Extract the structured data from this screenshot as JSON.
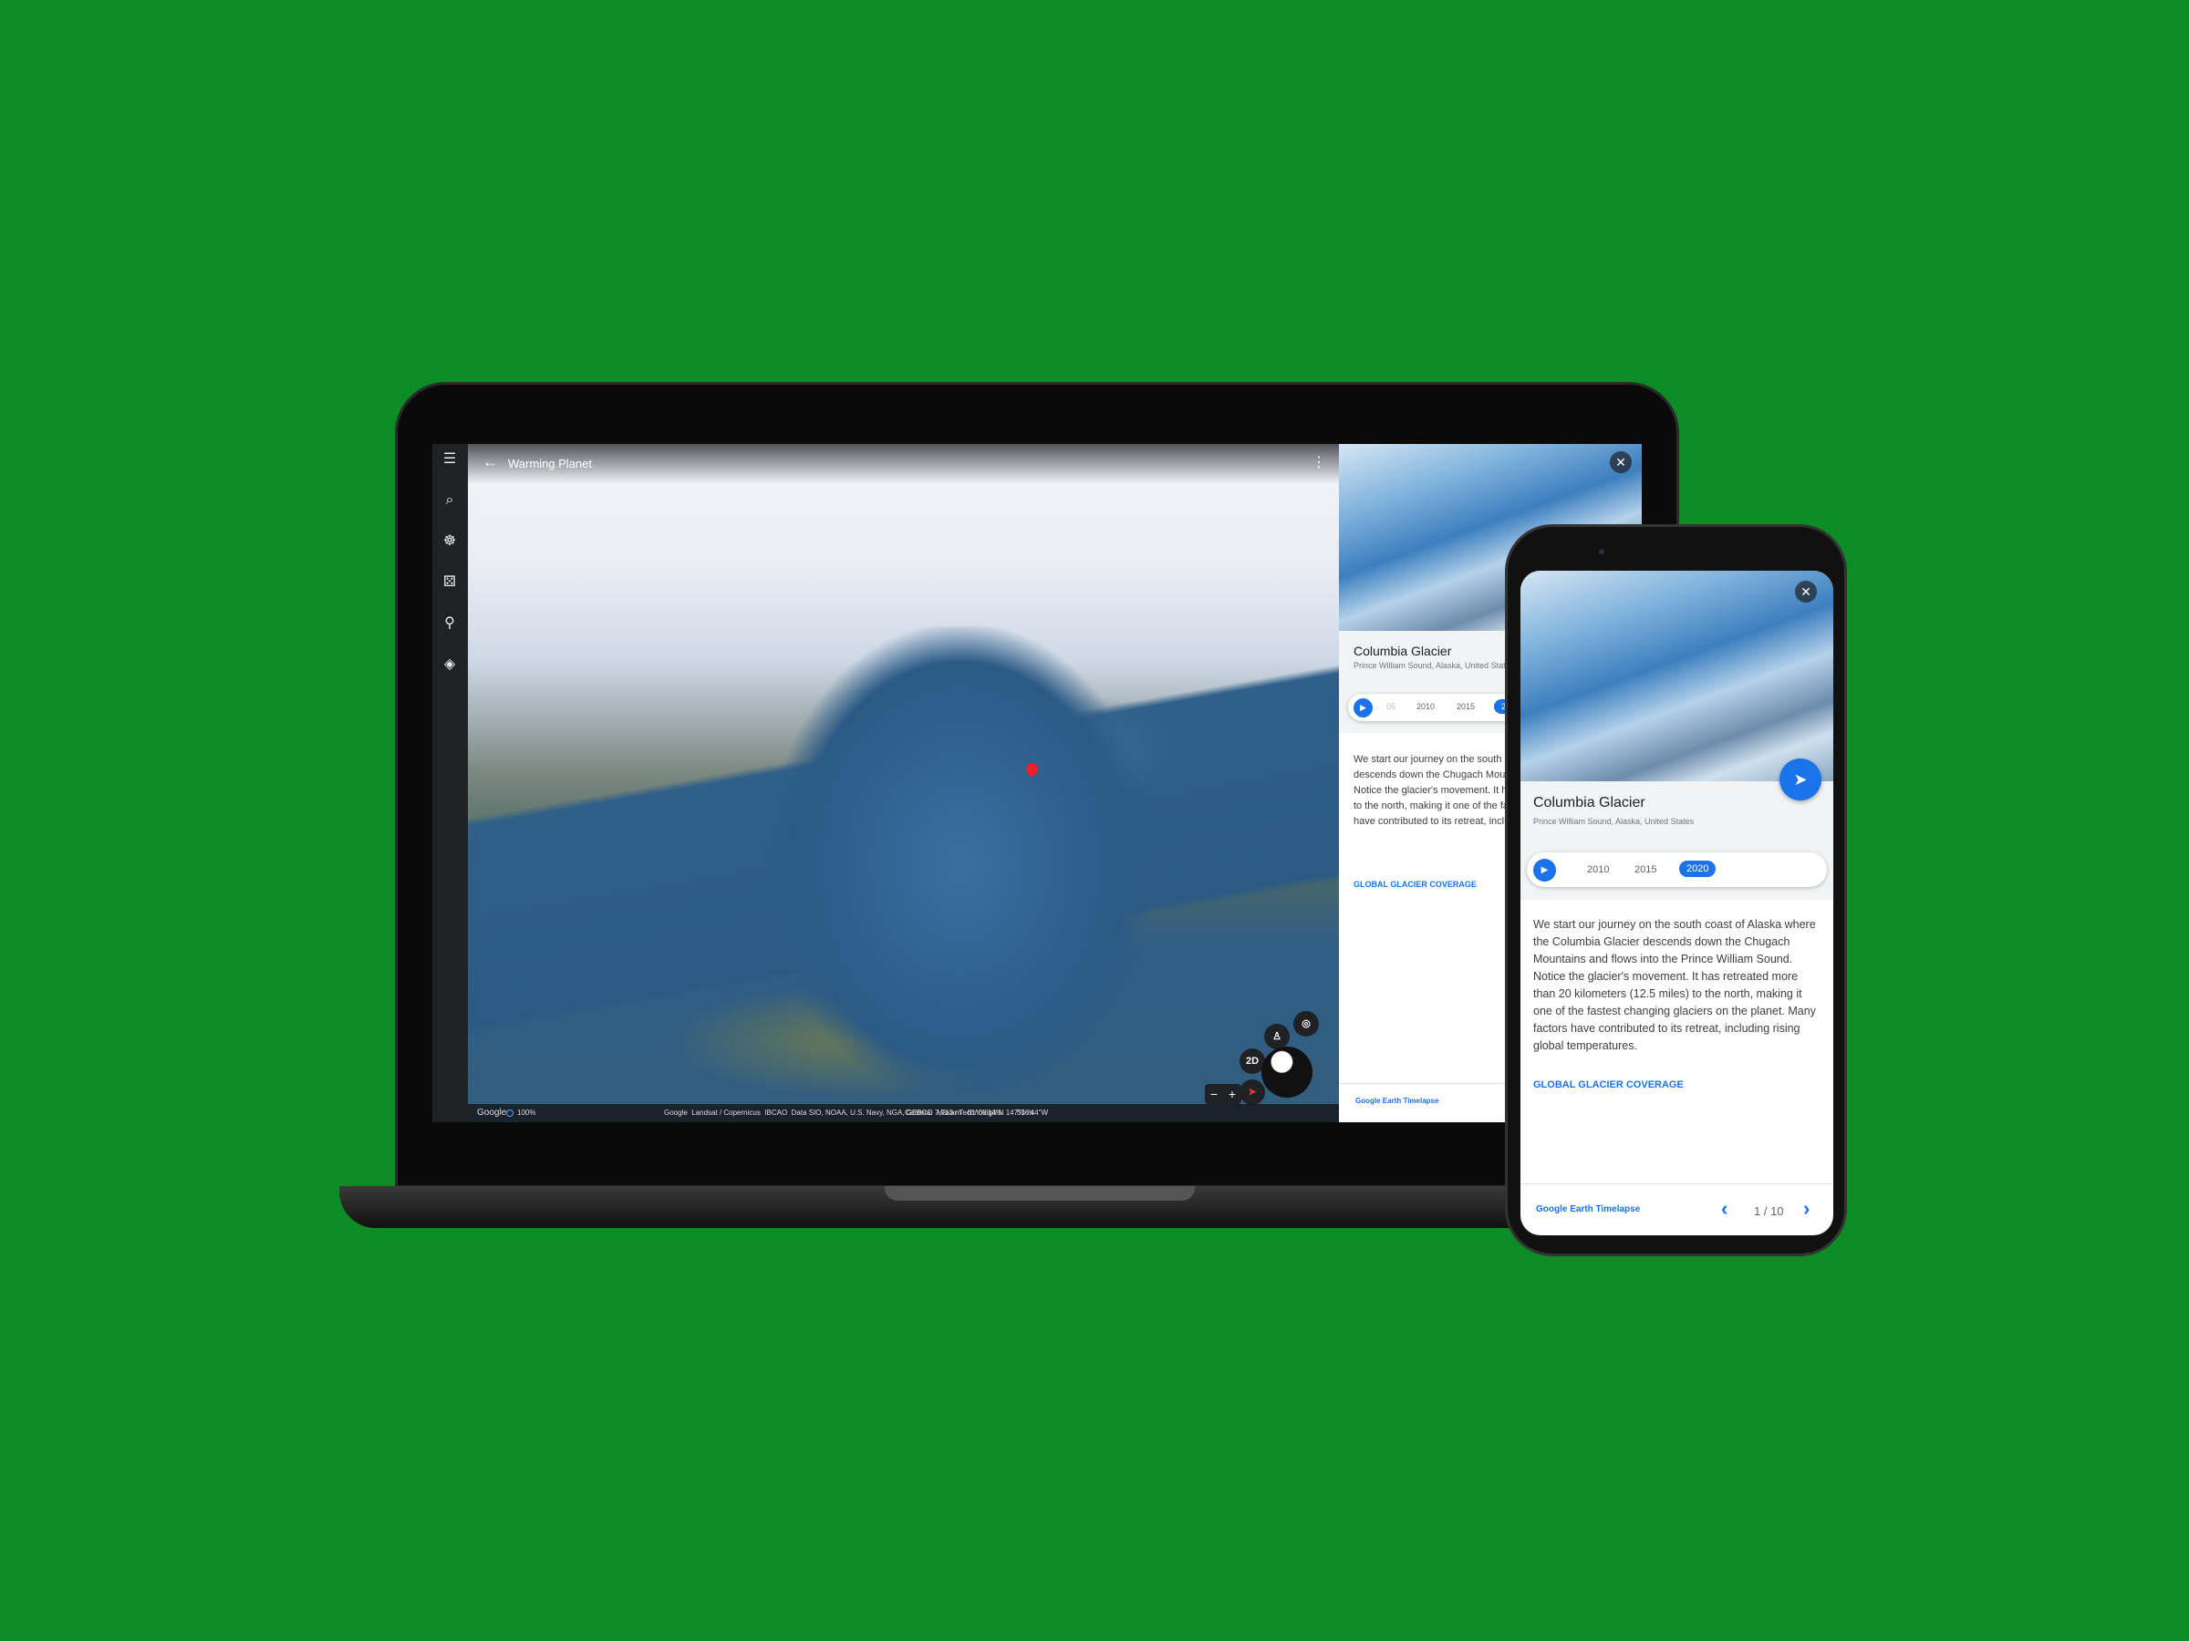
{
  "app": {
    "title": "Warming Planet"
  },
  "sidebar": {
    "items": [
      {
        "icon": "menu-icon",
        "glyph": "☰"
      },
      {
        "icon": "search-icon",
        "glyph": "⌕"
      },
      {
        "icon": "voyager-icon",
        "glyph": "☸"
      },
      {
        "icon": "random-icon",
        "glyph": "⚄"
      },
      {
        "icon": "projects-icon",
        "glyph": "⚲"
      },
      {
        "icon": "layers-icon",
        "glyph": "◈"
      }
    ]
  },
  "map": {
    "controls": {
      "view_mode": "2D",
      "zoom_out": "−",
      "zoom_in": "+"
    },
    "status": {
      "logo": "Google",
      "load": "100%",
      "attribution": "Google  Landsat / Copernicus  IBCAO  Data SIO, NOAA, U.S. Navy, NGA, GEBCO  Maxar Technologies",
      "camera": "Camera: 7,713 m   61°08'14\"N 147°06'44\"W",
      "scale": "51 m"
    }
  },
  "story": {
    "title": "Columbia Glacier",
    "subtitle": "Prince William Sound, Alaska, United States",
    "years": [
      "05",
      "2010",
      "2015",
      "2020"
    ],
    "selected_year": "2020",
    "body": "We start our journey on the south coast of Alaska where the Columbia Glacier descends down the Chugach Mountains and flows into the Prince William Sound. Notice the glacier's movement. It has retreated more than 20 kilometers (12.5 miles) to the north, making it one of the fastest changing glaciers on the planet. Many factors have contributed to its retreat, including rising global temperatures.",
    "link": "GLOBAL GLACIER COVERAGE",
    "footer": "Google Earth Timelapse",
    "page": "1 / 10"
  },
  "colors": {
    "background": "#0b8c24",
    "accent": "#1a73e8"
  }
}
